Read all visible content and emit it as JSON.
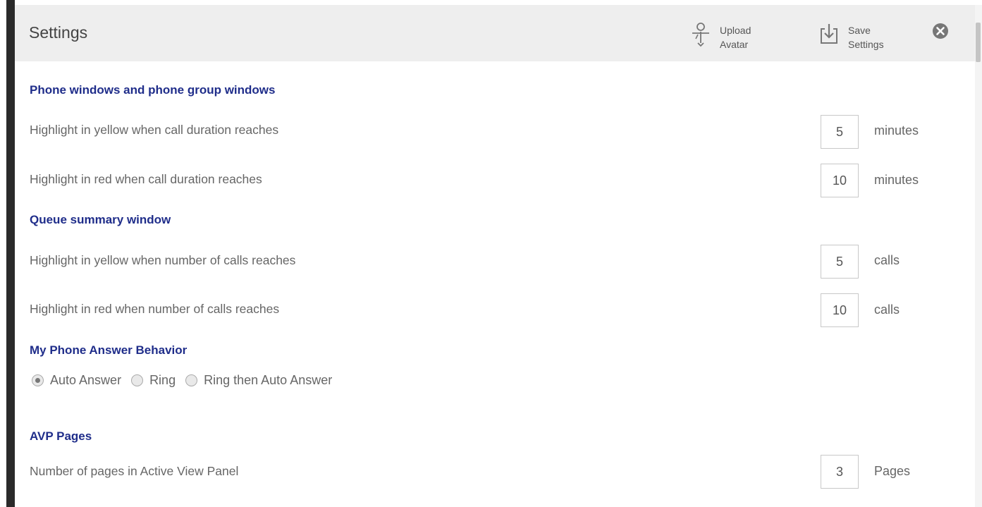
{
  "header": {
    "title": "Settings",
    "upload_avatar": {
      "line1": "Upload",
      "line2": "Avatar",
      "icon": "person-upload-icon"
    },
    "save_settings": {
      "line1": "Save",
      "line2": "Settings",
      "icon": "save-arrow-icon"
    },
    "close_icon": "close-circle-icon"
  },
  "sections": {
    "phone_windows": {
      "title": "Phone windows and phone group windows",
      "yellow_label": "Highlight in yellow when call duration reaches",
      "yellow_value": "5",
      "yellow_unit": "minutes",
      "red_label": "Highlight in red when call duration reaches",
      "red_value": "10",
      "red_unit": "minutes"
    },
    "queue_summary": {
      "title": "Queue summary window",
      "yellow_label": "Highlight in yellow when number of calls reaches",
      "yellow_value": "5",
      "yellow_unit": "calls",
      "red_label": "Highlight in red when number of calls reaches",
      "red_value": "10",
      "red_unit": "calls"
    },
    "answer_behavior": {
      "title": "My Phone Answer Behavior",
      "options": [
        "Auto Answer",
        "Ring",
        "Ring then Auto Answer"
      ],
      "selected": "Auto Answer"
    },
    "avp_pages": {
      "title": "AVP Pages",
      "pages_label": "Number of pages in Active View Panel",
      "pages_value": "3",
      "pages_unit": "Pages"
    }
  },
  "colors": {
    "section_title": "#1f2d8a",
    "header_bg": "#eeeeee",
    "left_bar": "#2a2a2a"
  }
}
